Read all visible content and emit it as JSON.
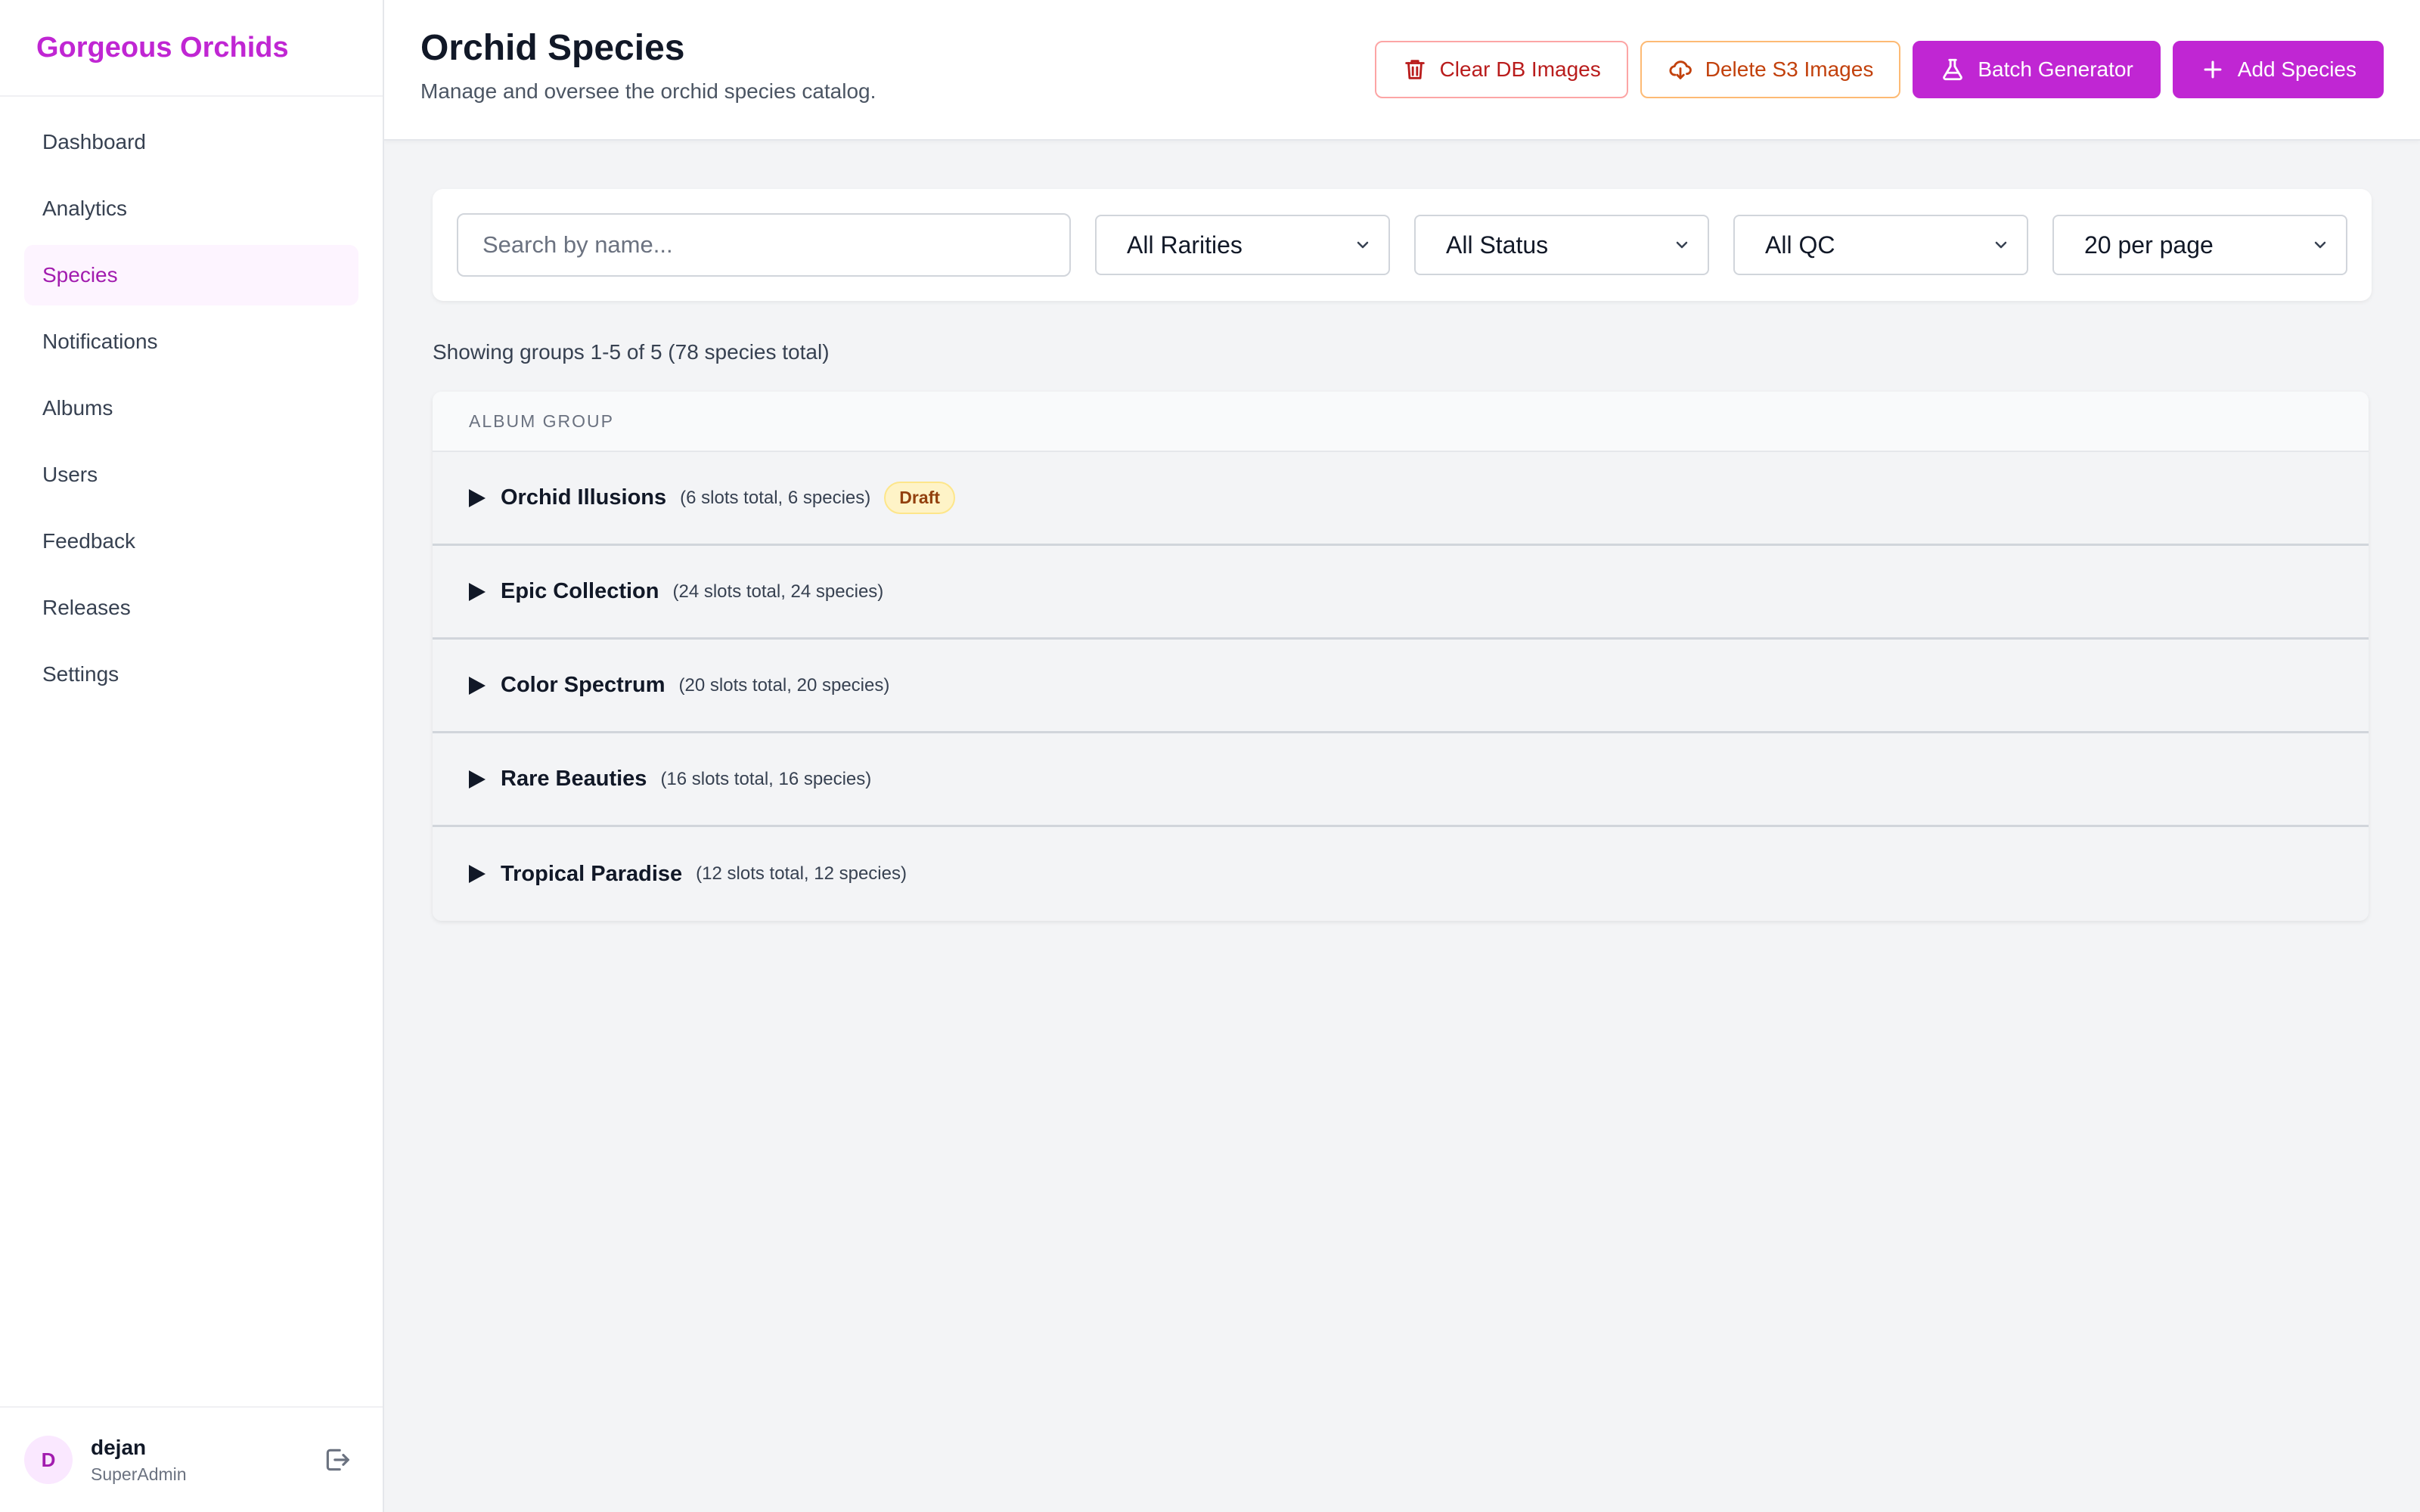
{
  "app": {
    "brand": "Gorgeous Orchids"
  },
  "sidebar": {
    "items": [
      {
        "label": "Dashboard",
        "active": false
      },
      {
        "label": "Analytics",
        "active": false
      },
      {
        "label": "Species",
        "active": true
      },
      {
        "label": "Notifications",
        "active": false
      },
      {
        "label": "Albums",
        "active": false
      },
      {
        "label": "Users",
        "active": false
      },
      {
        "label": "Feedback",
        "active": false
      },
      {
        "label": "Releases",
        "active": false
      },
      {
        "label": "Settings",
        "active": false
      }
    ],
    "user": {
      "initial": "D",
      "name": "dejan",
      "role": "SuperAdmin",
      "logout_icon": "logout-icon"
    }
  },
  "header": {
    "title": "Orchid Species",
    "subtitle": "Manage and oversee the orchid species catalog.",
    "actions": {
      "clear_db": {
        "label": "Clear DB Images",
        "icon": "trash-icon"
      },
      "delete_s3": {
        "label": "Delete S3 Images",
        "icon": "cloud-download-icon"
      },
      "batch": {
        "label": "Batch Generator",
        "icon": "flask-icon"
      },
      "add": {
        "label": "Add Species",
        "icon": "plus-icon"
      }
    }
  },
  "filters": {
    "search_placeholder": "Search by name...",
    "search_value": "",
    "rarity": "All Rarities",
    "status": "All Status",
    "qc": "All QC",
    "per_page": "20 per page"
  },
  "summary": "Showing groups 1-5 of 5 (78 species total)",
  "table": {
    "header": "Album Group",
    "groups": [
      {
        "name": "Orchid Illusions",
        "meta": "(6 slots total, 6 species)",
        "badge": "Draft"
      },
      {
        "name": "Epic Collection",
        "meta": "(24 slots total, 24 species)",
        "badge": ""
      },
      {
        "name": "Color Spectrum",
        "meta": "(20 slots total, 20 species)",
        "badge": ""
      },
      {
        "name": "Rare Beauties",
        "meta": "(16 slots total, 16 species)",
        "badge": ""
      },
      {
        "name": "Tropical Paradise",
        "meta": "(12 slots total, 12 species)",
        "badge": ""
      }
    ]
  },
  "colors": {
    "brand": "#c026d3",
    "active_bg": "#fdf4ff",
    "danger": "#b91c1c",
    "warning": "#c2410c"
  }
}
